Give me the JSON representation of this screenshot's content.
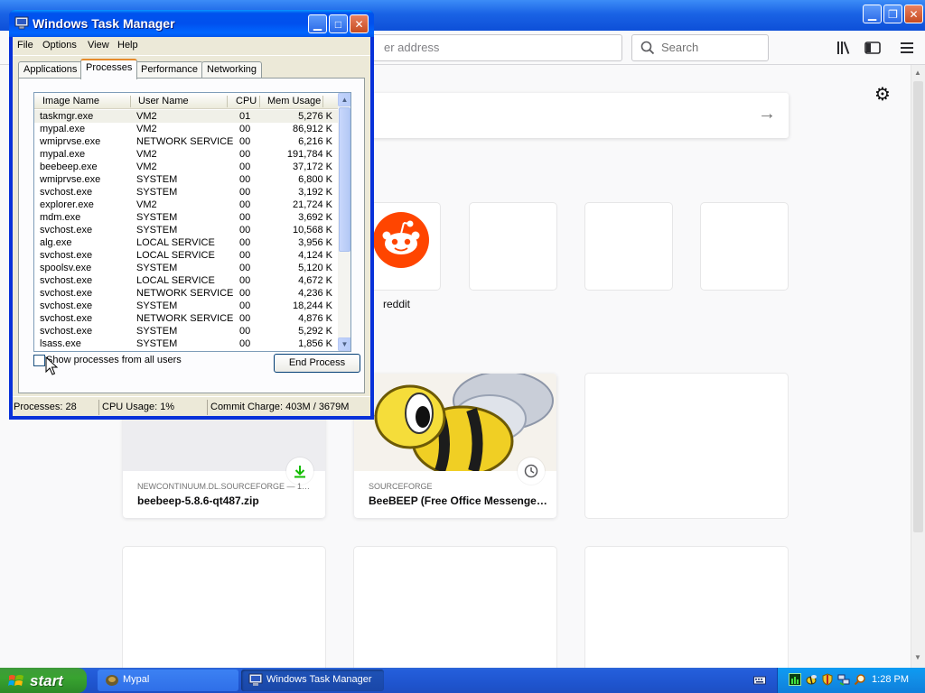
{
  "browser": {
    "url_placeholder": "er address",
    "search_placeholder": "Search",
    "top_site": {
      "label": "reddit"
    },
    "highlights": [
      {
        "source": "NEWCONTINUUM.DL.SOURCEFORGE — 1…",
        "title": "beebeep-5.8.6-qt487.zip",
        "badge": "download-icon"
      },
      {
        "source": "SOURCEFORGE",
        "title": "BeeBEEP (Free Office Messenge…",
        "badge": "clock-icon"
      }
    ]
  },
  "task_manager": {
    "title": "Windows Task Manager",
    "menu": [
      "File",
      "Options",
      "View",
      "Help"
    ],
    "tabs": [
      "Applications",
      "Processes",
      "Performance",
      "Networking"
    ],
    "active_tab": "Processes",
    "columns": [
      "Image Name",
      "User Name",
      "CPU",
      "Mem Usage"
    ],
    "rows": [
      [
        "taskmgr.exe",
        "VM2",
        "01",
        "5,276 K"
      ],
      [
        "mypal.exe",
        "VM2",
        "00",
        "86,912 K"
      ],
      [
        "wmiprvse.exe",
        "NETWORK SERVICE",
        "00",
        "6,216 K"
      ],
      [
        "mypal.exe",
        "VM2",
        "00",
        "191,784 K"
      ],
      [
        "beebeep.exe",
        "VM2",
        "00",
        "37,172 K"
      ],
      [
        "wmiprvse.exe",
        "SYSTEM",
        "00",
        "6,800 K"
      ],
      [
        "svchost.exe",
        "SYSTEM",
        "00",
        "3,192 K"
      ],
      [
        "explorer.exe",
        "VM2",
        "00",
        "21,724 K"
      ],
      [
        "mdm.exe",
        "SYSTEM",
        "00",
        "3,692 K"
      ],
      [
        "svchost.exe",
        "SYSTEM",
        "00",
        "10,568 K"
      ],
      [
        "alg.exe",
        "LOCAL SERVICE",
        "00",
        "3,956 K"
      ],
      [
        "svchost.exe",
        "LOCAL SERVICE",
        "00",
        "4,124 K"
      ],
      [
        "spoolsv.exe",
        "SYSTEM",
        "00",
        "5,120 K"
      ],
      [
        "svchost.exe",
        "LOCAL SERVICE",
        "00",
        "4,672 K"
      ],
      [
        "svchost.exe",
        "NETWORK SERVICE",
        "00",
        "4,236 K"
      ],
      [
        "svchost.exe",
        "SYSTEM",
        "00",
        "18,244 K"
      ],
      [
        "svchost.exe",
        "NETWORK SERVICE",
        "00",
        "4,876 K"
      ],
      [
        "svchost.exe",
        "SYSTEM",
        "00",
        "5,292 K"
      ],
      [
        "lsass.exe",
        "SYSTEM",
        "00",
        "1,856 K"
      ]
    ],
    "show_all_label": "Show processes from all users",
    "end_process_label": "End Process",
    "status": {
      "processes": "Processes: 28",
      "cpu": "CPU Usage: 1%",
      "commit": "Commit Charge: 403M / 3679M"
    }
  },
  "taskbar": {
    "start_label": "start",
    "tasks": [
      {
        "label": "Mypal",
        "active": false
      },
      {
        "label": "Windows Task Manager",
        "active": true
      }
    ],
    "clock": "1:28 PM"
  }
}
